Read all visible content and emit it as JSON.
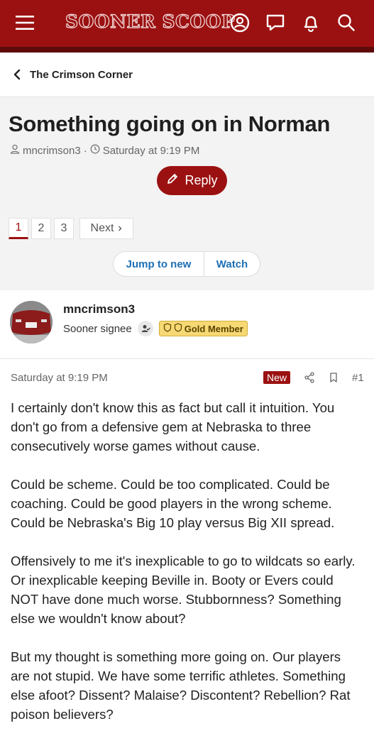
{
  "header": {
    "logo_text": "SOONER SCOOP",
    "icons": [
      "menu-icon",
      "account-icon",
      "messages-icon",
      "alerts-icon",
      "search-icon"
    ],
    "colors": {
      "brand": "#9b1111",
      "link": "#1f6fb5",
      "gold": "#f6d874"
    }
  },
  "breadcrumb": {
    "label": "The Crimson Corner"
  },
  "thread": {
    "title": "Something going on in Norman",
    "author": "mncrimson3",
    "separator": "·",
    "date": "Saturday at 9:19 PM",
    "reply_label": "Reply",
    "pages": [
      "1",
      "2",
      "3"
    ],
    "current_page": "1",
    "next_label": "Next",
    "jump_label": "Jump to new",
    "watch_label": "Watch"
  },
  "author_card": {
    "username": "mncrimson3",
    "role": "Sooner signee",
    "badge": "Gold Member"
  },
  "post": {
    "date": "Saturday at 9:19 PM",
    "new_badge": "New",
    "number": "#1",
    "paragraphs": [
      "I certainly don't know this as fact but call it intuition. You don't go from a defensive gem at Nebraska to three consecutively worse games without cause.",
      "Could be scheme. Could be too complicated. Could be coaching. Could be good players in the wrong scheme. Could be Nebraska's Big 10 play versus Big XII spread.",
      "Offensively to me it's inexplicable to go to wildcats so early. Or inexplicable keeping Beville in. Booty or Evers could NOT have done much worse. Stubbornness? Something else we wouldn't know about?",
      "But my thought is something more going on. Our players are not stupid. We have some terrific athletes. Something else afoot? Dissent? Malaise? Discontent? Rebellion? Rat poison believers?"
    ]
  }
}
